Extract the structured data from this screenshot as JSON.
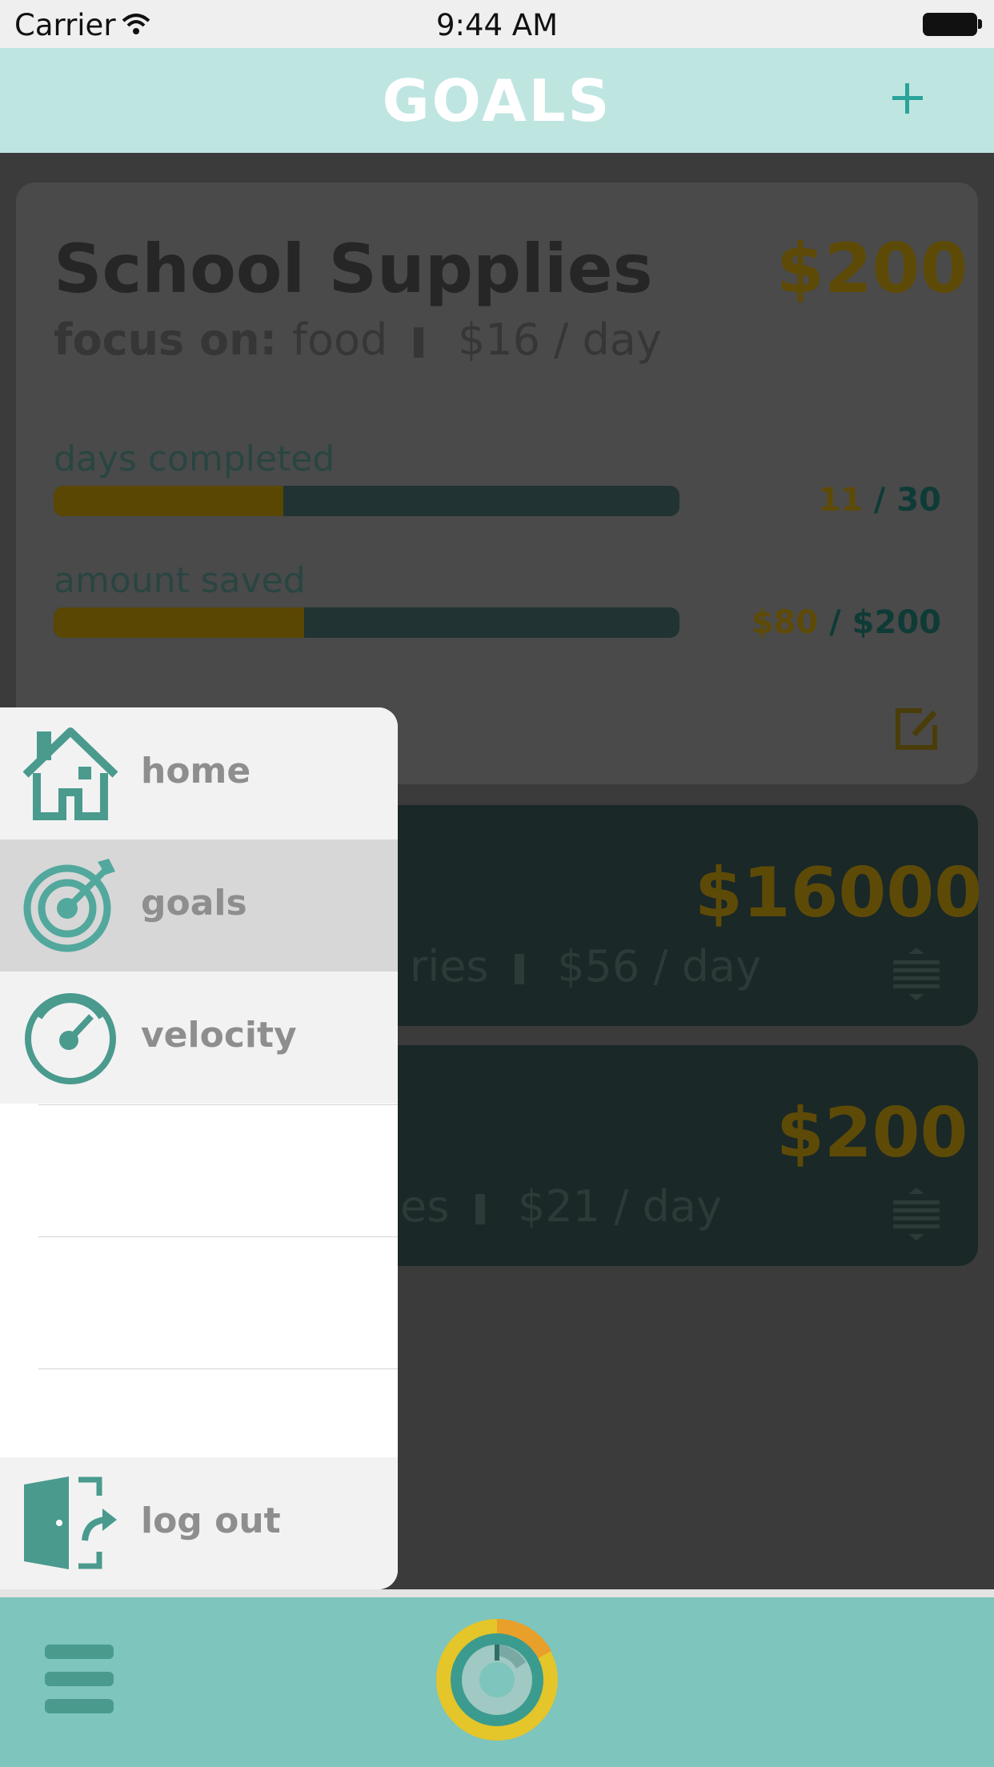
{
  "status_bar": {
    "carrier": "Carrier",
    "time": "9:44 AM"
  },
  "nav": {
    "title": "GOALS",
    "add_label": "+"
  },
  "goals": [
    {
      "title": "School Supplies",
      "amount": "$200",
      "focus_prefix": "focus on:",
      "focus": "food",
      "per_day": "$16 / day",
      "days_label": "days completed",
      "days_done": "11",
      "days_total": "/ 30",
      "days_fraction": 0.367,
      "saved_label": "amount saved",
      "saved_done": "$80",
      "saved_total": "/ $200",
      "saved_fraction": 0.4
    },
    {
      "amount": "$16000",
      "sub_fragment": "ries",
      "per_day": "$56 / day"
    },
    {
      "amount": "$200",
      "sub_fragment": "es",
      "per_day": "$21 / day"
    }
  ],
  "menu": {
    "items": [
      {
        "label": "home",
        "icon": "house-icon",
        "active": false
      },
      {
        "label": "goals",
        "icon": "target-icon",
        "active": true
      },
      {
        "label": "velocity",
        "icon": "speedometer-icon",
        "active": false
      }
    ],
    "logout_label": "log out"
  },
  "colors": {
    "nav_bg": "#bfe5e1",
    "accent_teal": "#4a9a8e",
    "bottom_bar": "#7dc5bd",
    "gold": "#e4c52a"
  }
}
